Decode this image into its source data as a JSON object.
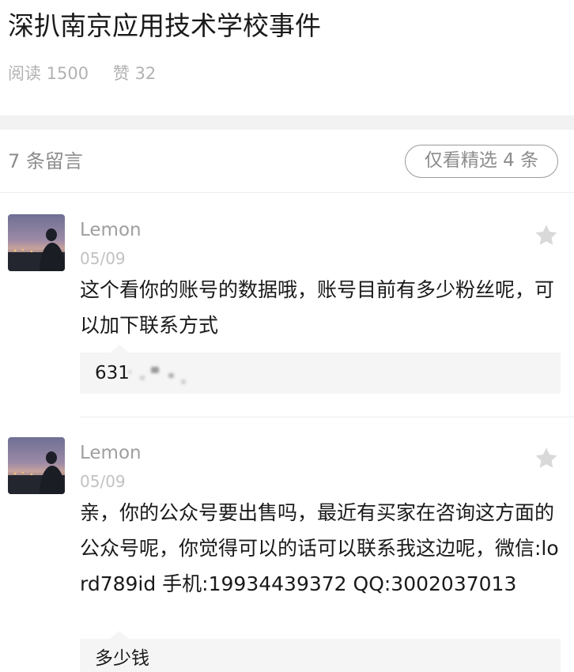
{
  "article": {
    "title": "深扒南京应用技术学校事件",
    "reads": "阅读 1500",
    "likes": "赞 32"
  },
  "comments_header": {
    "count_label": "7 条留言",
    "featured_button": "仅看精选 4 条"
  },
  "comments": [
    {
      "nickname": "Lemon",
      "date": "05/09",
      "text": "这个看你的账号的数据哦，账号目前有多少粉丝呢，可以加下联系方式",
      "reply": "631"
    },
    {
      "nickname": "Lemon",
      "date": "05/09",
      "text": "亲，你的公众号要出售吗，最近有买家在咨询这方面的公众号呢，你觉得可以的话可以联系我这边呢，微信:lord789id 手机:19934439372 QQ:3002037013",
      "reply": "多少钱"
    }
  ],
  "icons": {
    "star": "star-icon",
    "avatar": "avatar-photo"
  },
  "colors": {
    "text_primary": "#1a1a1a",
    "text_secondary": "#9e9e9e",
    "star_gray": "#d9d9d9",
    "reply_bg": "#f5f5f5"
  }
}
